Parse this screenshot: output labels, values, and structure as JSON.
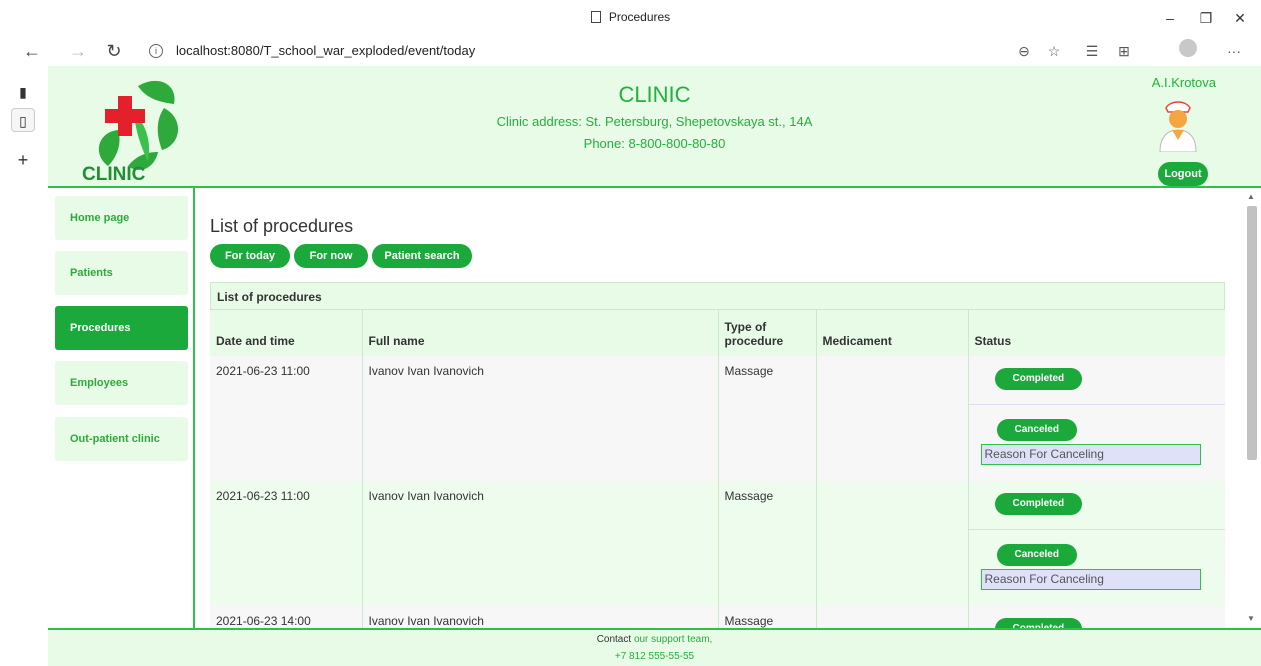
{
  "browser": {
    "tab_title": "Procedures",
    "url": "localhost:8080/T_school_war_exploded/event/today"
  },
  "header": {
    "logo_text": "CLINIC",
    "title": "CLINIC",
    "address": "Clinic address: St. Petersburg, Shepetovskaya st., 14A",
    "phone": "Phone: 8-800-800-80-80",
    "user": "A.I.Krotova",
    "logout": "Logout",
    "colors": {
      "accent": "#1aa93a",
      "background": "#e7fbe7"
    }
  },
  "sidebar": {
    "items": [
      {
        "label": "Home page"
      },
      {
        "label": "Patients"
      },
      {
        "label": "Procedures"
      },
      {
        "label": "Employees"
      },
      {
        "label": "Out-patient clinic"
      }
    ]
  },
  "main": {
    "title": "List of procedures",
    "buttons": {
      "today": "For today",
      "now": "For now",
      "search": "Patient search"
    },
    "table": {
      "caption": "List of procedures",
      "headers": [
        "Date and time",
        "Full name",
        "Type of procedure",
        "Medicament",
        "Status"
      ],
      "rows": [
        {
          "datetime": "2021-06-23 11:00",
          "name": "Ivanov Ivan Ivanovich",
          "type": "Massage",
          "medicament": "",
          "completed": "Completed",
          "canceled": "Canceled",
          "reason_placeholder": "Reason For Canceling"
        },
        {
          "datetime": "2021-06-23 11:00",
          "name": "Ivanov Ivan Ivanovich",
          "type": "Massage",
          "medicament": "",
          "completed": "Completed",
          "canceled": "Canceled",
          "reason_placeholder": "Reason For Canceling"
        },
        {
          "datetime": "2021-06-23 14:00",
          "name": "Ivanov Ivan Ivanovich",
          "type": "Massage",
          "medicament": "",
          "completed": "Completed"
        }
      ]
    }
  },
  "footer": {
    "contact_prefix": "Contact",
    "contact_link": "our support team,",
    "phone": "+7 812 555-55-55"
  }
}
